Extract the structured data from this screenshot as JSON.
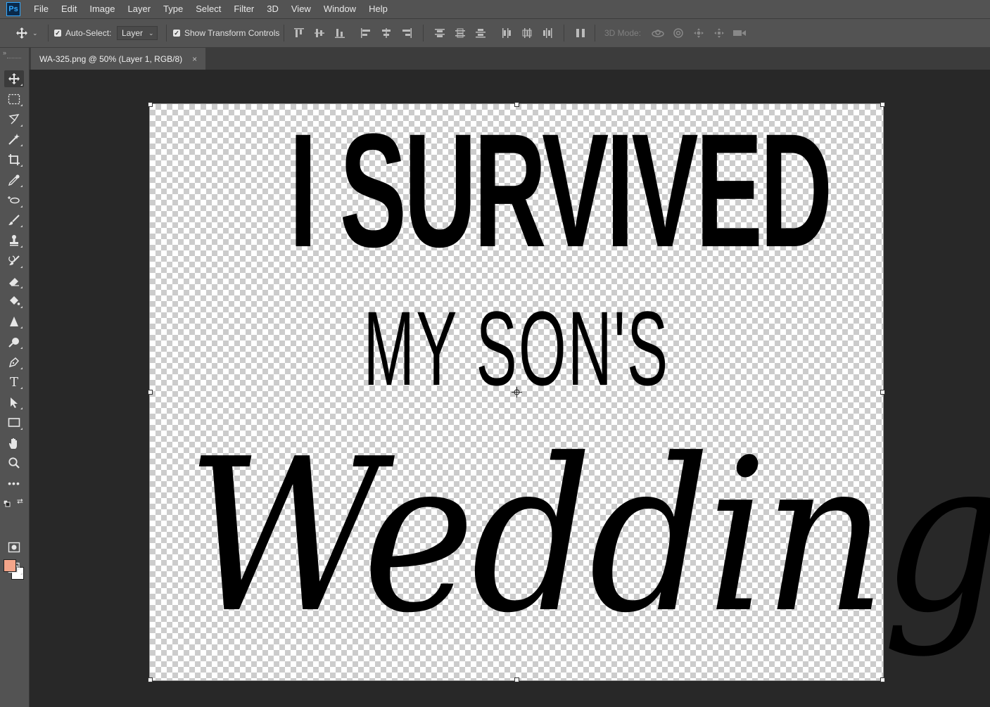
{
  "app": {
    "logo": "Ps"
  },
  "menu": [
    "File",
    "Edit",
    "Image",
    "Layer",
    "Type",
    "Select",
    "Filter",
    "3D",
    "View",
    "Window",
    "Help"
  ],
  "options": {
    "auto_select_label": "Auto-Select:",
    "auto_select_checked": true,
    "auto_select_target": "Layer",
    "show_transform_label": "Show Transform Controls",
    "show_transform_checked": true,
    "mode_3d_label": "3D Mode:"
  },
  "document": {
    "tab_title": "WA-325.png @ 50% (Layer 1, RGB/8)",
    "close": "×"
  },
  "artwork": {
    "line1": "I SURVIVED",
    "line2": "MY SON'S",
    "line3": "Wedding"
  },
  "tools": [
    "move-tool",
    "marquee-tool",
    "lasso-tool",
    "magic-wand-tool",
    "crop-tool",
    "eyedropper-tool",
    "healing-brush-tool",
    "brush-tool",
    "stamp-tool",
    "history-brush-tool",
    "eraser-tool",
    "paint-bucket-tool",
    "sharpen-tool",
    "dodge-tool",
    "pen-tool",
    "type-tool",
    "path-selection-tool",
    "rectangle-tool",
    "hand-tool",
    "zoom-tool",
    "more-tools"
  ],
  "colors": {
    "foreground": "#f4a58a",
    "background": "#ffffff",
    "accent": "#31a8ff"
  }
}
